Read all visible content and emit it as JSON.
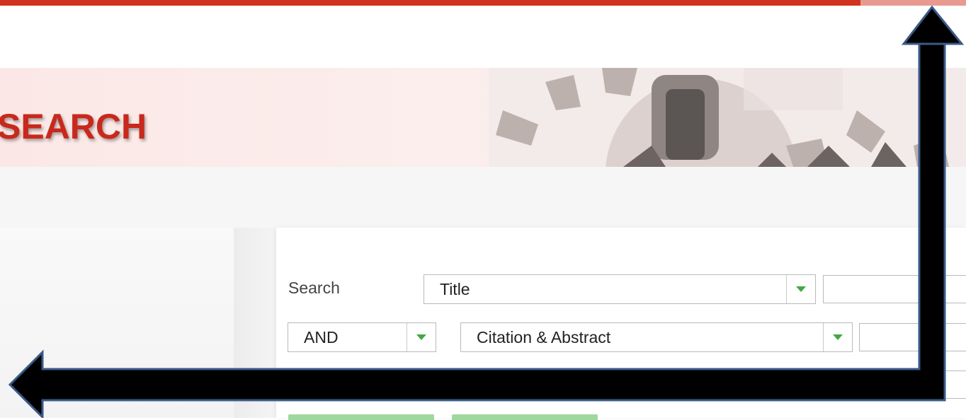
{
  "banner": {
    "title": "SEARCH"
  },
  "form": {
    "row1": {
      "label": "Search",
      "field": "Title"
    },
    "row2": {
      "operator": "AND",
      "field": "Citation & Abstract"
    }
  },
  "icons": {
    "dropdown": "chevron-down-icon",
    "annotation": "arrow-annotation-icon"
  },
  "colors": {
    "brand": "#d0341e",
    "title": "#c8291c",
    "dropdown_arrow": "#43a843",
    "button": "#9fd89f"
  }
}
